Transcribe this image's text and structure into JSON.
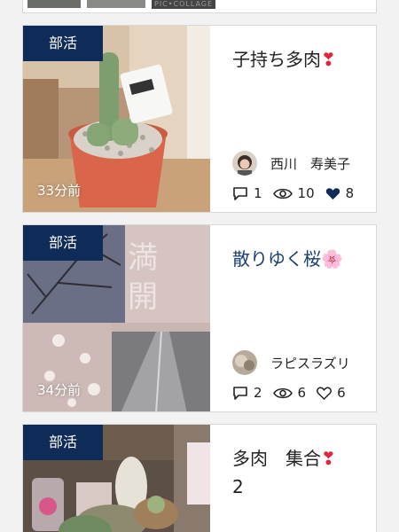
{
  "top_card": {
    "collage_label": "PIC•COLLAGE"
  },
  "posts": [
    {
      "badge": "部活",
      "time": "33分前",
      "title": "子持ち多肉",
      "title_emoji": "❣",
      "author": "西川　寿美子",
      "comments": "1",
      "views": "10",
      "likes": "8",
      "liked": true
    },
    {
      "badge": "部活",
      "time": "34分前",
      "title": "散りゆく桜",
      "title_emoji": "🌸",
      "author": "ラピスラズリ",
      "comments": "2",
      "views": "6",
      "likes": "6",
      "liked": false
    },
    {
      "badge": "部活",
      "title": "多肉　集合",
      "title_emoji": "❣",
      "title_line2": "2"
    }
  ],
  "colors": {
    "badge_bg": "#0f2b57",
    "title_accent": "#1b3f73",
    "heart_emoji": "#e0263c"
  }
}
